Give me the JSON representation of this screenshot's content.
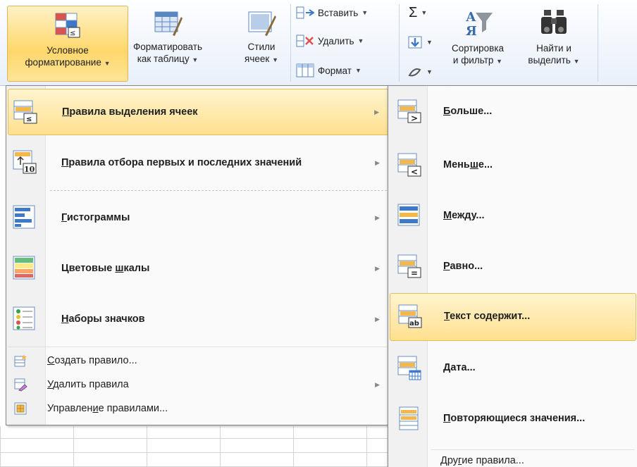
{
  "ribbon": {
    "conditional_formatting": {
      "line1": "Условное",
      "line2": "форматирование",
      "icon": "conditional-formatting-icon"
    },
    "format_as_table": {
      "line1": "Форматировать",
      "line2": "как таблицу",
      "icon": "format-as-table-icon"
    },
    "cell_styles": {
      "line1": "Стили",
      "line2": "ячеек",
      "icon": "cell-styles-icon"
    },
    "insert": {
      "label": "Вставить",
      "icon": "insert-cells-icon"
    },
    "delete": {
      "label": "Удалить",
      "icon": "delete-cells-icon"
    },
    "format": {
      "label": "Формат",
      "icon": "format-cells-icon"
    },
    "autosum_symbol": "Σ",
    "sort_filter": {
      "line1": "Сортировка",
      "line2": "и фильтр",
      "icon": "sort-filter-icon"
    },
    "find_select": {
      "line1": "Найти и",
      "line2": "выделить",
      "icon": "binoculars-icon"
    }
  },
  "menu": {
    "items": [
      {
        "pre": "",
        "key": "П",
        "post": "равила выделения ячеек",
        "icon": "highlight-cells-rules-icon"
      },
      {
        "pre": "",
        "key": "П",
        "post": "равила отбора первых и последних значений",
        "icon": "top-bottom-rules-icon"
      },
      {
        "pre": "",
        "key": "Г",
        "post": "истограммы",
        "icon": "data-bars-icon"
      },
      {
        "pre": "Цветовые ",
        "key": "ш",
        "post": "калы",
        "icon": "color-scales-icon"
      },
      {
        "pre": "",
        "key": "Н",
        "post": "аборы значков",
        "icon": "icon-sets-icon"
      }
    ],
    "small_items": [
      {
        "pre": "",
        "key": "С",
        "post": "оздать правило...",
        "icon": "new-rule-icon"
      },
      {
        "pre": "",
        "key": "У",
        "post": "далить правила",
        "icon": "clear-rules-icon"
      },
      {
        "pre": "Управлен",
        "key": "и",
        "post": "е правилами...",
        "icon": "manage-rules-icon"
      }
    ]
  },
  "submenu": {
    "items": [
      {
        "pre": "",
        "key": "Б",
        "post": "ольше...",
        "icon": "greater-than-icon"
      },
      {
        "pre": "Мень",
        "key": "ш",
        "post": "е...",
        "icon": "less-than-icon"
      },
      {
        "pre": "",
        "key": "М",
        "post": "ежду...",
        "icon": "between-icon"
      },
      {
        "pre": "",
        "key": "Р",
        "post": "авно...",
        "icon": "equal-to-icon"
      },
      {
        "pre": "",
        "key": "Т",
        "post": "екст содержит...",
        "icon": "text-contains-icon"
      },
      {
        "pre": "",
        "key": "Д",
        "post": "ата...",
        "icon": "date-occurring-icon"
      },
      {
        "pre": "",
        "key": "П",
        "post": "овторяющиеся значения...",
        "icon": "duplicate-values-icon"
      }
    ],
    "more_rules": {
      "pre": "Дру",
      "key": "г",
      "post": "ие правила..."
    }
  },
  "colors": {
    "highlight": "#ffe08f",
    "highlight_border": "#e7bd56",
    "ribbon_bg": "#e9f0fa"
  }
}
